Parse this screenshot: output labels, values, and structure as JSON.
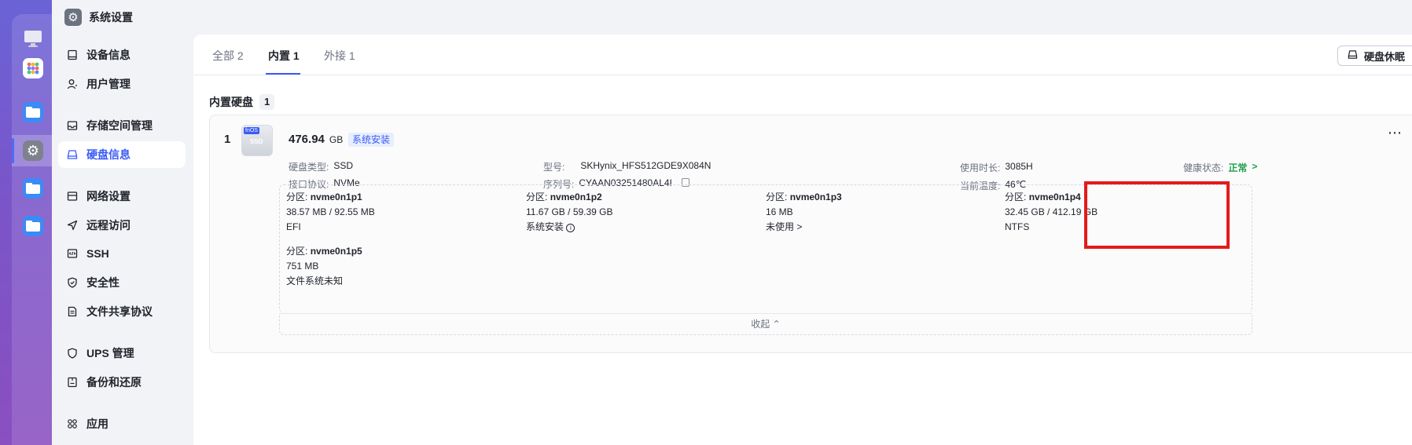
{
  "app": {
    "title": "系统设置"
  },
  "dock": {
    "apps": [
      {
        "icon": "monitor-icon"
      },
      {
        "icon": "app-grid-icon"
      },
      {
        "icon": "folder-icon"
      },
      {
        "icon": "settings-icon"
      },
      {
        "icon": "folder-icon"
      },
      {
        "icon": "folder-icon"
      }
    ]
  },
  "sidebar": {
    "items": [
      {
        "label": "设备信息",
        "icon": "device-icon"
      },
      {
        "label": "用户管理",
        "icon": "user-icon"
      },
      {
        "label": "存储空间管理",
        "icon": "storage-icon"
      },
      {
        "label": "硬盘信息",
        "icon": "disk-icon",
        "active": true
      },
      {
        "label": "网络设置",
        "icon": "network-icon"
      },
      {
        "label": "远程访问",
        "icon": "remote-icon"
      },
      {
        "label": "SSH",
        "icon": "code-icon"
      },
      {
        "label": "安全性",
        "icon": "shield-check-icon"
      },
      {
        "label": "文件共享协议",
        "icon": "file-share-icon"
      },
      {
        "label": "UPS 管理",
        "icon": "ups-icon"
      },
      {
        "label": "备份和还原",
        "icon": "backup-icon"
      },
      {
        "label": "应用",
        "icon": "apps-icon"
      }
    ]
  },
  "tabs": [
    {
      "label": "全部 2"
    },
    {
      "label": "内置 1",
      "active": true
    },
    {
      "label": "外接 1"
    }
  ],
  "toolbar": {
    "sleep_label": "硬盘休眠"
  },
  "section": {
    "title": "内置硬盘",
    "count": "1"
  },
  "disk": {
    "index": "1",
    "icon_tag": "fnOS",
    "icon_text": "SSD",
    "size": "476.94",
    "size_unit": "GB",
    "badge": "系统安装",
    "fields": {
      "type_label": "硬盘类型:",
      "type_value": "SSD",
      "interface_label": "接口协议:",
      "interface_value": "NVMe",
      "model_label": "型号:",
      "model_value": "SKHynix_HFS512GDE9X084N",
      "serial_label": "序列号:",
      "serial_value": "CYAAN03251480AL4I",
      "hours_label": "使用时长:",
      "hours_value": "3085H",
      "temp_label": "当前温度:",
      "temp_value": "46℃",
      "health_label": "健康状态:",
      "health_value": "正常",
      "health_arrow": ">"
    },
    "partitions": [
      {
        "label": "分区:",
        "name": "nvme0n1p1",
        "usage": "38.57 MB / 92.55 MB",
        "fs": "EFI"
      },
      {
        "label": "分区:",
        "name": "nvme0n1p2",
        "usage": "11.67 GB / 59.39 GB",
        "fs": "系统安装",
        "fs_icon": "info-icon"
      },
      {
        "label": "分区:",
        "name": "nvme0n1p3",
        "usage": "16 MB",
        "fs": "未使用 >"
      },
      {
        "label": "分区:",
        "name": "nvme0n1p4",
        "usage": "32.45 GB / 412.19 GB",
        "fs": "NTFS"
      },
      {
        "label": "分区:",
        "name": "nvme0n1p5",
        "usage": "751 MB",
        "fs": "文件系统未知"
      }
    ],
    "collapse_label": "收起 ⌃",
    "more": "⋯"
  }
}
